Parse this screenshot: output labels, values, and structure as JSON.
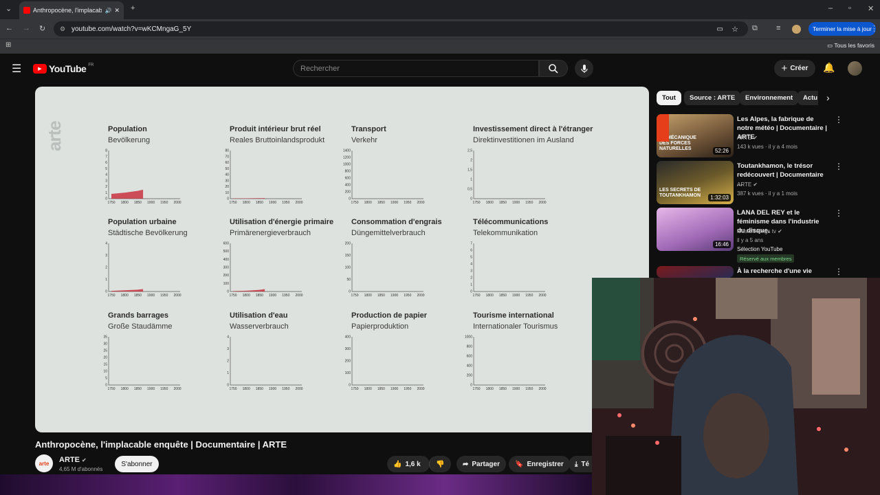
{
  "browser": {
    "tab_title": "Anthropocène, l'implacable",
    "url": "youtube.com/watch?v=wKCMngaG_5Y",
    "update_button": "Terminer la mise à jour",
    "bookmarks_label": "Tous les favoris"
  },
  "youtube": {
    "logo_text": "YouTube",
    "region": "FR",
    "search_placeholder": "Rechercher",
    "create_label": "Créer"
  },
  "video": {
    "watermark": "arte",
    "charts": [
      {
        "title": "Population",
        "subtitle": "Bevölkerung",
        "yticks": [
          "8",
          "7",
          "6",
          "5",
          "4",
          "3",
          "2",
          "1",
          "0"
        ]
      },
      {
        "title": "Produit intérieur brut réel",
        "subtitle": "Reales Bruttoinlandsprodukt",
        "yticks": [
          "80",
          "70",
          "60",
          "50",
          "40",
          "30",
          "20",
          "10",
          "0"
        ]
      },
      {
        "title": "Transport",
        "subtitle": "Verkehr",
        "yticks": [
          "1400",
          "1200",
          "1000",
          "800",
          "600",
          "400",
          "200",
          "0"
        ]
      },
      {
        "title": "Investissement direct à l'étranger",
        "subtitle": "Direktinvestitionen im Ausland",
        "yticks": [
          "2,5",
          "2",
          "1,5",
          "1",
          "0,5",
          "0"
        ]
      },
      {
        "title": "Population urbaine",
        "subtitle": "Städtische Bevölkerung",
        "yticks": [
          "4",
          "3",
          "2",
          "1",
          "0"
        ]
      },
      {
        "title": "Utilisation d'énergie primaire",
        "subtitle": "Primärenergieverbrauch",
        "yticks": [
          "600",
          "500",
          "400",
          "300",
          "200",
          "100",
          "0"
        ]
      },
      {
        "title": "Consommation d'engrais",
        "subtitle": "Düngemittelverbrauch",
        "yticks": [
          "200",
          "150",
          "100",
          "50",
          "0"
        ]
      },
      {
        "title": "Télécommunications",
        "subtitle": "Telekommunikation",
        "yticks": [
          "7",
          "6",
          "5",
          "4",
          "3",
          "2",
          "1",
          "0"
        ]
      },
      {
        "title": "Grands barrages",
        "subtitle": "Große Staudämme",
        "yticks": [
          "35",
          "30",
          "25",
          "20",
          "15",
          "10",
          "5",
          "0"
        ]
      },
      {
        "title": "Utilisation d'eau",
        "subtitle": "Wasserverbrauch",
        "yticks": [
          "4",
          "3",
          "2",
          "1",
          "0"
        ]
      },
      {
        "title": "Production de papier",
        "subtitle": "Papierproduktion",
        "yticks": [
          "400",
          "300",
          "200",
          "100",
          "0"
        ]
      },
      {
        "title": "Tourisme international",
        "subtitle": "Internationaler Tourismus",
        "yticks": [
          "1000",
          "800",
          "600",
          "400",
          "200",
          "0"
        ]
      }
    ],
    "xticks": [
      "1750",
      "1800",
      "1850",
      "1900",
      "1950",
      "2000"
    ],
    "title": "Anthropocène, l'implacable enquête | Documentaire | ARTE"
  },
  "chart_data": [
    {
      "type": "area",
      "title": "Population",
      "ylim": [
        0,
        8
      ],
      "x": [
        1750,
        1800,
        1850,
        1870
      ],
      "values": [
        0.8,
        1.0,
        1.3,
        1.5
      ]
    },
    {
      "type": "area",
      "title": "Produit intérieur brut réel",
      "ylim": [
        0,
        80
      ],
      "x": [
        1750,
        1800,
        1850,
        1870
      ],
      "values": [
        0.5,
        0.6,
        0.8,
        1.0
      ]
    },
    {
      "type": "area",
      "title": "Transport",
      "ylim": [
        0,
        1400
      ],
      "x": [
        1750,
        1850
      ],
      "values": [
        0,
        0
      ]
    },
    {
      "type": "area",
      "title": "Investissement direct à l'étranger",
      "ylim": [
        0,
        2.5
      ],
      "x": [
        1750,
        1850
      ],
      "values": [
        0,
        0
      ]
    },
    {
      "type": "area",
      "title": "Population urbaine",
      "ylim": [
        0,
        4
      ],
      "x": [
        1750,
        1800,
        1850,
        1870
      ],
      "values": [
        0.05,
        0.1,
        0.15,
        0.2
      ]
    },
    {
      "type": "area",
      "title": "Utilisation d'énergie primaire",
      "ylim": [
        0,
        600
      ],
      "x": [
        1750,
        1800,
        1850,
        1870
      ],
      "values": [
        5,
        10,
        20,
        30
      ]
    },
    {
      "type": "area",
      "title": "Consommation d'engrais",
      "ylim": [
        0,
        200
      ],
      "x": [
        1750,
        1850
      ],
      "values": [
        0,
        0
      ]
    },
    {
      "type": "area",
      "title": "Télécommunications",
      "ylim": [
        0,
        7
      ],
      "x": [
        1750,
        1850
      ],
      "values": [
        0,
        0
      ]
    },
    {
      "type": "area",
      "title": "Grands barrages",
      "ylim": [
        0,
        35
      ],
      "x": [
        1750,
        1850
      ],
      "values": [
        0,
        0
      ]
    },
    {
      "type": "area",
      "title": "Utilisation d'eau",
      "ylim": [
        0,
        4
      ],
      "x": [
        1750,
        1850
      ],
      "values": [
        0,
        0
      ]
    },
    {
      "type": "area",
      "title": "Production de papier",
      "ylim": [
        0,
        400
      ],
      "x": [
        1750,
        1850
      ],
      "values": [
        0,
        0
      ]
    },
    {
      "type": "area",
      "title": "Tourisme international",
      "ylim": [
        0,
        1000
      ],
      "x": [
        1750,
        1850
      ],
      "values": [
        0,
        0
      ]
    }
  ],
  "channel": {
    "name": "ARTE",
    "logo": "arte",
    "subscribers": "4,65 M d'abonnés",
    "subscribe_label": "S'abonner"
  },
  "actions": {
    "likes": "1,6 k",
    "share": "Partager",
    "save": "Enregistrer",
    "download_partial": "Té"
  },
  "chips": [
    "Tout",
    "Source : ARTE",
    "Environnement",
    "Actu"
  ],
  "related": [
    {
      "title": "Les Alpes, la fabrique de notre météo | Documentaire | ARTE",
      "channel": "ARTE",
      "meta": "143 k vues · il y a 4 mois",
      "duration": "52:26",
      "thumb_text": "LA MÉCANIQUE DES FORCES NATURELLES"
    },
    {
      "title": "Toutankhamon, le trésor redécouvert | Documentaire ...",
      "channel": "ARTE",
      "meta": "387 k vues · il y a 1 mois",
      "duration": "1:32:03",
      "thumb_text": "LES SECRETS DE TOUTANKHAMON"
    },
    {
      "title": "LANA DEL REY et le féminisme dans l'industrie du disque.",
      "channel": "Musicfeelings tv",
      "meta": "il y a 5 ans",
      "extra": "Sélection YouTube",
      "badge": "Réservé aux membres",
      "duration": "16:46"
    },
    {
      "title": "À la recherche d'une vie"
    }
  ],
  "colors": {
    "accent": "#ff0000",
    "chart_fill": "#c9323f",
    "video_bg": "#dde2df"
  }
}
